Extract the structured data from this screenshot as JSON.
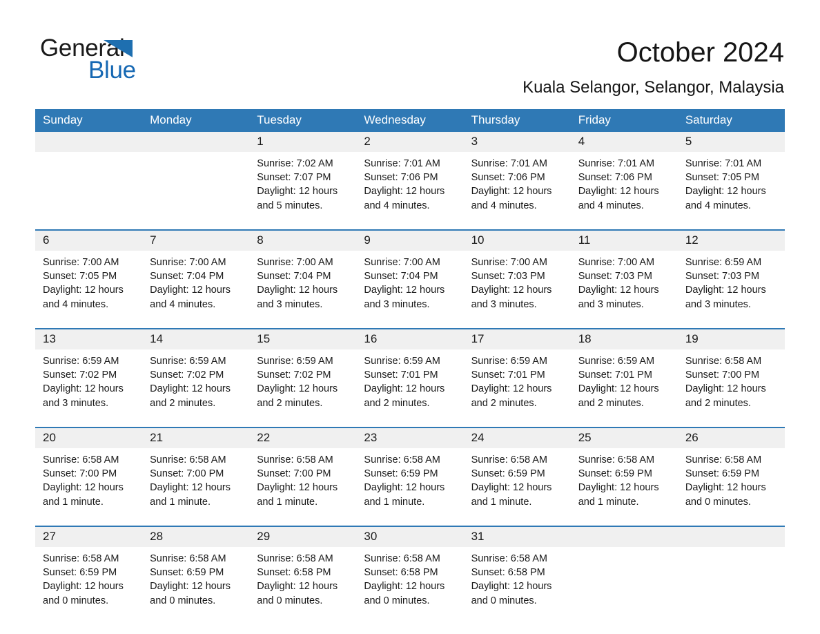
{
  "brand": {
    "name_part1": "General",
    "name_part2": "Blue",
    "triangle_color": "#1e6fb0",
    "blue_text_color": "#1668b3"
  },
  "header": {
    "title": "October 2024",
    "subtitle": "Kuala Selangor, Selangor, Malaysia"
  },
  "theme": {
    "header_blue": "#2f79b5",
    "daynum_band": "#f0f0f0",
    "cell_background": "#ffffff",
    "text_color": "#1a1a1a"
  },
  "weekdays": [
    "Sunday",
    "Monday",
    "Tuesday",
    "Wednesday",
    "Thursday",
    "Friday",
    "Saturday"
  ],
  "weeks": [
    {
      "days": [
        {
          "num": "",
          "info": ""
        },
        {
          "num": "",
          "info": ""
        },
        {
          "num": "1",
          "info": "Sunrise: 7:02 AM\nSunset: 7:07 PM\nDaylight: 12 hours\nand 5 minutes."
        },
        {
          "num": "2",
          "info": "Sunrise: 7:01 AM\nSunset: 7:06 PM\nDaylight: 12 hours\nand 4 minutes."
        },
        {
          "num": "3",
          "info": "Sunrise: 7:01 AM\nSunset: 7:06 PM\nDaylight: 12 hours\nand 4 minutes."
        },
        {
          "num": "4",
          "info": "Sunrise: 7:01 AM\nSunset: 7:06 PM\nDaylight: 12 hours\nand 4 minutes."
        },
        {
          "num": "5",
          "info": "Sunrise: 7:01 AM\nSunset: 7:05 PM\nDaylight: 12 hours\nand 4 minutes."
        }
      ]
    },
    {
      "days": [
        {
          "num": "6",
          "info": "Sunrise: 7:00 AM\nSunset: 7:05 PM\nDaylight: 12 hours\nand 4 minutes."
        },
        {
          "num": "7",
          "info": "Sunrise: 7:00 AM\nSunset: 7:04 PM\nDaylight: 12 hours\nand 4 minutes."
        },
        {
          "num": "8",
          "info": "Sunrise: 7:00 AM\nSunset: 7:04 PM\nDaylight: 12 hours\nand 3 minutes."
        },
        {
          "num": "9",
          "info": "Sunrise: 7:00 AM\nSunset: 7:04 PM\nDaylight: 12 hours\nand 3 minutes."
        },
        {
          "num": "10",
          "info": "Sunrise: 7:00 AM\nSunset: 7:03 PM\nDaylight: 12 hours\nand 3 minutes."
        },
        {
          "num": "11",
          "info": "Sunrise: 7:00 AM\nSunset: 7:03 PM\nDaylight: 12 hours\nand 3 minutes."
        },
        {
          "num": "12",
          "info": "Sunrise: 6:59 AM\nSunset: 7:03 PM\nDaylight: 12 hours\nand 3 minutes."
        }
      ]
    },
    {
      "days": [
        {
          "num": "13",
          "info": "Sunrise: 6:59 AM\nSunset: 7:02 PM\nDaylight: 12 hours\nand 3 minutes."
        },
        {
          "num": "14",
          "info": "Sunrise: 6:59 AM\nSunset: 7:02 PM\nDaylight: 12 hours\nand 2 minutes."
        },
        {
          "num": "15",
          "info": "Sunrise: 6:59 AM\nSunset: 7:02 PM\nDaylight: 12 hours\nand 2 minutes."
        },
        {
          "num": "16",
          "info": "Sunrise: 6:59 AM\nSunset: 7:01 PM\nDaylight: 12 hours\nand 2 minutes."
        },
        {
          "num": "17",
          "info": "Sunrise: 6:59 AM\nSunset: 7:01 PM\nDaylight: 12 hours\nand 2 minutes."
        },
        {
          "num": "18",
          "info": "Sunrise: 6:59 AM\nSunset: 7:01 PM\nDaylight: 12 hours\nand 2 minutes."
        },
        {
          "num": "19",
          "info": "Sunrise: 6:58 AM\nSunset: 7:00 PM\nDaylight: 12 hours\nand 2 minutes."
        }
      ]
    },
    {
      "days": [
        {
          "num": "20",
          "info": "Sunrise: 6:58 AM\nSunset: 7:00 PM\nDaylight: 12 hours\nand 1 minute."
        },
        {
          "num": "21",
          "info": "Sunrise: 6:58 AM\nSunset: 7:00 PM\nDaylight: 12 hours\nand 1 minute."
        },
        {
          "num": "22",
          "info": "Sunrise: 6:58 AM\nSunset: 7:00 PM\nDaylight: 12 hours\nand 1 minute."
        },
        {
          "num": "23",
          "info": "Sunrise: 6:58 AM\nSunset: 6:59 PM\nDaylight: 12 hours\nand 1 minute."
        },
        {
          "num": "24",
          "info": "Sunrise: 6:58 AM\nSunset: 6:59 PM\nDaylight: 12 hours\nand 1 minute."
        },
        {
          "num": "25",
          "info": "Sunrise: 6:58 AM\nSunset: 6:59 PM\nDaylight: 12 hours\nand 1 minute."
        },
        {
          "num": "26",
          "info": "Sunrise: 6:58 AM\nSunset: 6:59 PM\nDaylight: 12 hours\nand 0 minutes."
        }
      ]
    },
    {
      "days": [
        {
          "num": "27",
          "info": "Sunrise: 6:58 AM\nSunset: 6:59 PM\nDaylight: 12 hours\nand 0 minutes."
        },
        {
          "num": "28",
          "info": "Sunrise: 6:58 AM\nSunset: 6:59 PM\nDaylight: 12 hours\nand 0 minutes."
        },
        {
          "num": "29",
          "info": "Sunrise: 6:58 AM\nSunset: 6:58 PM\nDaylight: 12 hours\nand 0 minutes."
        },
        {
          "num": "30",
          "info": "Sunrise: 6:58 AM\nSunset: 6:58 PM\nDaylight: 12 hours\nand 0 minutes."
        },
        {
          "num": "31",
          "info": "Sunrise: 6:58 AM\nSunset: 6:58 PM\nDaylight: 12 hours\nand 0 minutes."
        },
        {
          "num": "",
          "info": ""
        },
        {
          "num": "",
          "info": ""
        }
      ]
    }
  ]
}
